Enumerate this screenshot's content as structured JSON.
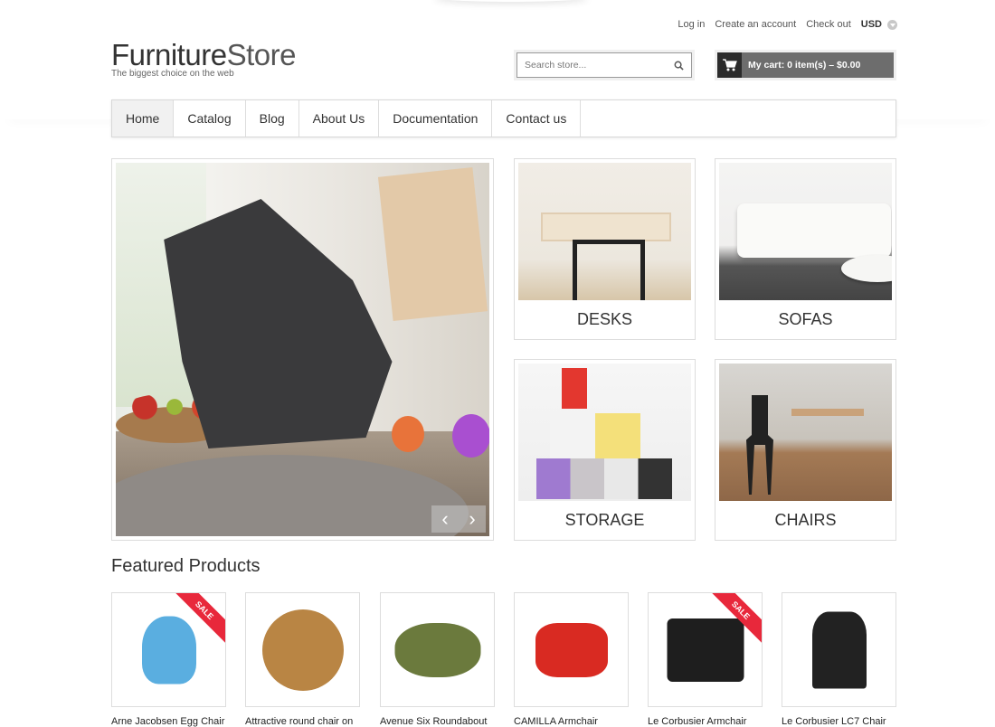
{
  "header": {
    "top_links": [
      "Log in",
      "Create an account",
      "Check out"
    ],
    "currency": "USD",
    "logo": {
      "part1": "Furniture",
      "part2": "Store",
      "tagline": "The biggest choice on the web"
    },
    "search": {
      "placeholder": "Search store..."
    },
    "cart": {
      "label": "My cart: 0 item(s) – $0.00"
    }
  },
  "nav": {
    "items": [
      "Home",
      "Catalog",
      "Blog",
      "About Us",
      "Documentation",
      "Contact us"
    ],
    "active": "Home"
  },
  "slider": {
    "prev": "‹",
    "next": "›"
  },
  "categories": [
    "DESKS",
    "SOFAS",
    "STORAGE",
    "CHAIRS"
  ],
  "featured": {
    "title": "Featured Products",
    "sale_label": "SALE",
    "products": [
      {
        "name": "Arne Jacobsen Egg Chair",
        "sale": true,
        "color": "#5aaee0"
      },
      {
        "name": "Attractive round chair on",
        "sale": false,
        "color": "#b98544"
      },
      {
        "name": "Avenue Six Roundabout",
        "sale": false,
        "color": "#6b7a3d"
      },
      {
        "name": "CAMILLA Armchair",
        "sale": false,
        "color": "#d92a22"
      },
      {
        "name": "Le Corbusier Armchair",
        "sale": true,
        "color": "#1e1e1e"
      },
      {
        "name": "Le Corbusier LC7 Chair",
        "sale": false,
        "color": "#222222"
      }
    ]
  }
}
